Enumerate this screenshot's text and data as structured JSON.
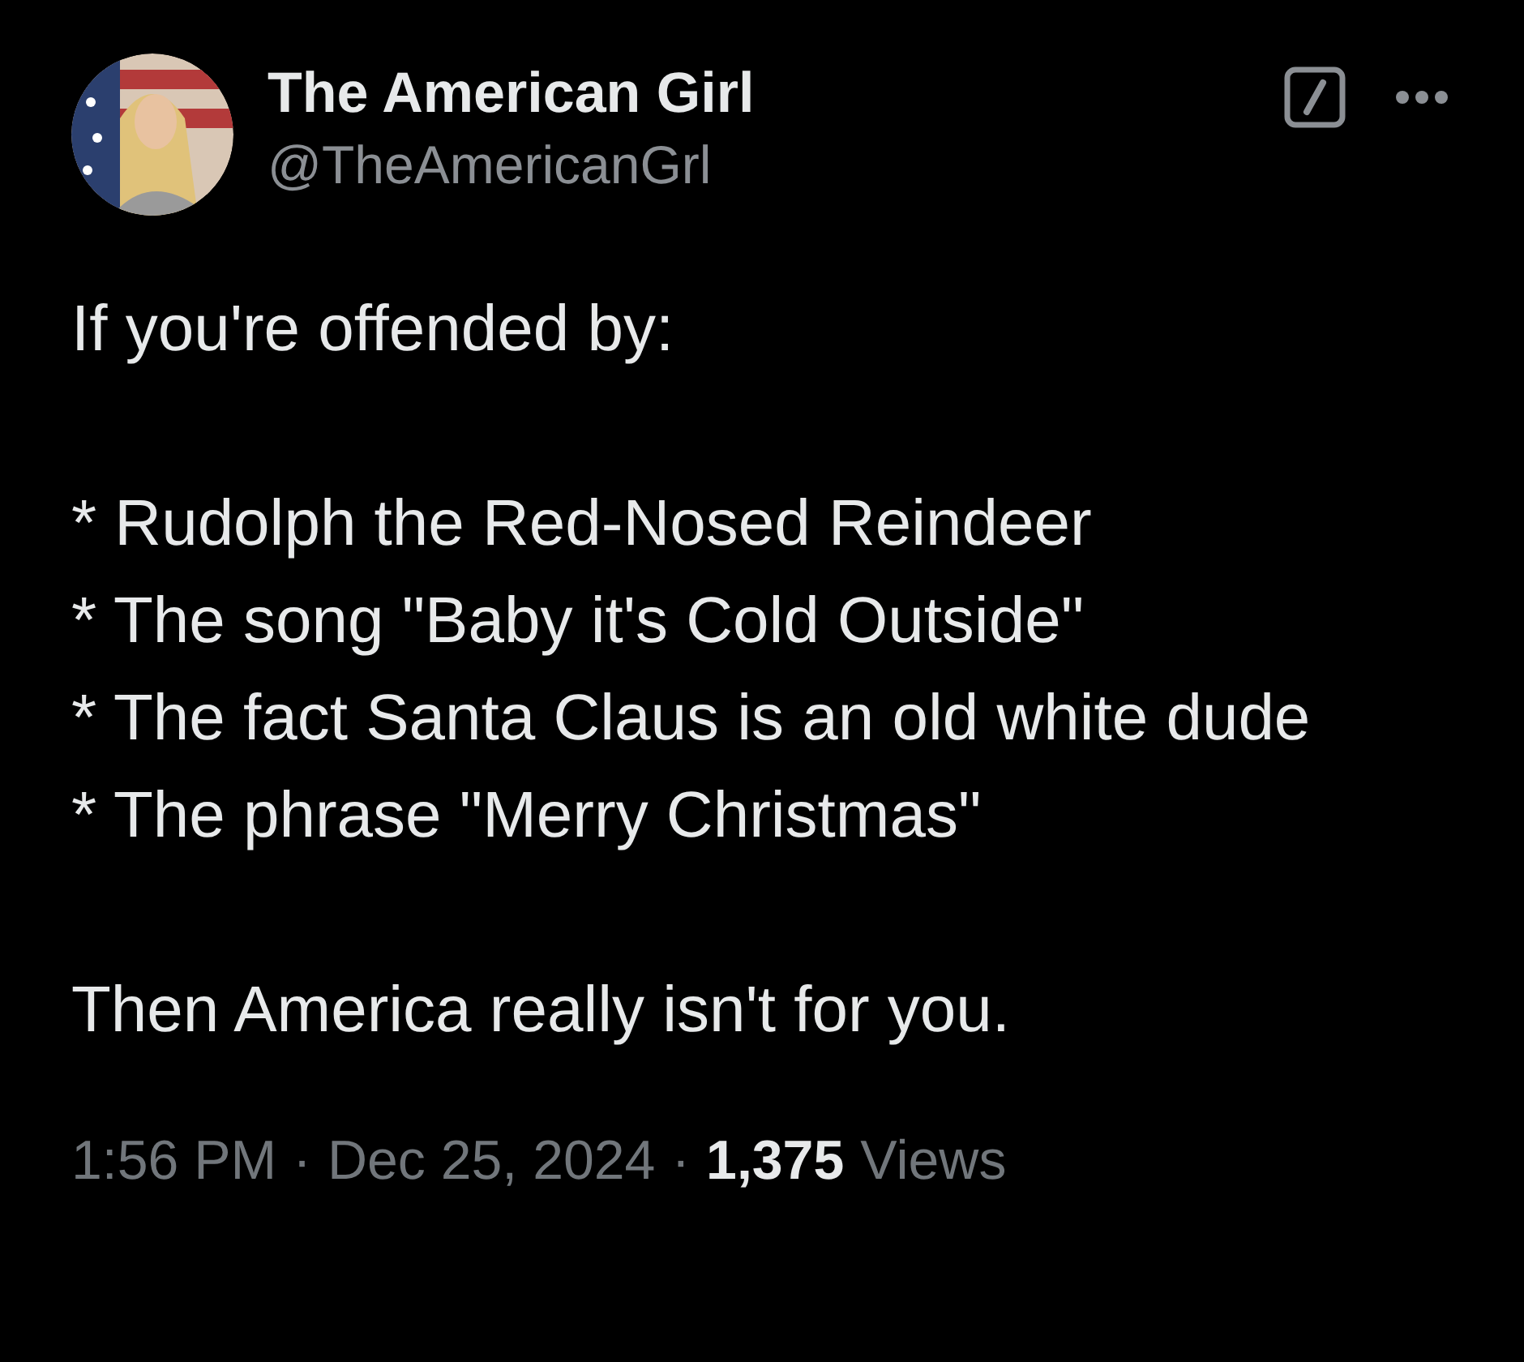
{
  "author": {
    "name": "The American Girl",
    "handle": "@TheAmericanGrl"
  },
  "body": {
    "intro": "If you're offended by:",
    "items": [
      "* Rudolph the Red-Nosed Reindeer",
      "* The song \"Baby it's Cold Outside\"",
      "* The fact Santa Claus is an old white dude",
      "* The phrase \"Merry Christmas\""
    ],
    "closing": "Then America really isn't for you."
  },
  "meta": {
    "time": "1:56 PM",
    "separator_1": "·",
    "date": "Dec 25, 2024",
    "separator_2": "·",
    "views_count": "1,375",
    "views_label": "Views"
  }
}
